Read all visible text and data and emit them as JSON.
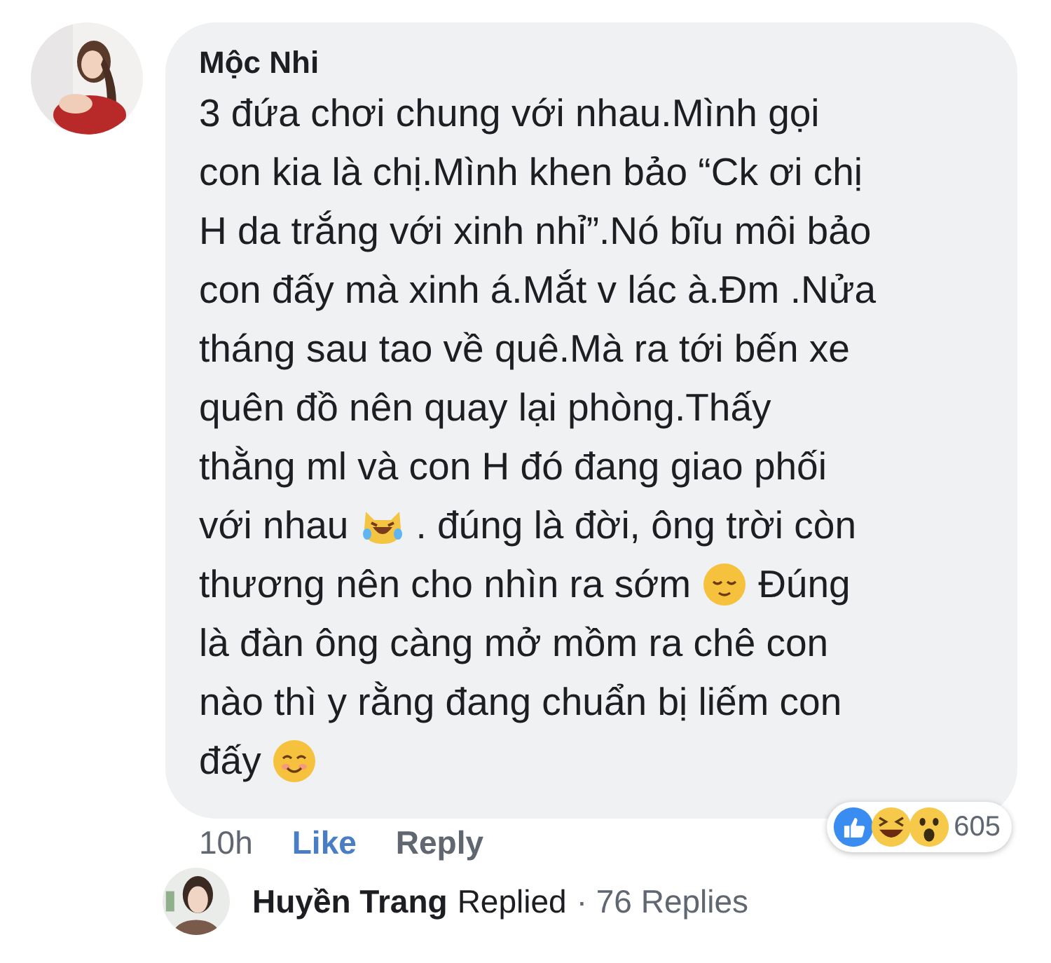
{
  "comment": {
    "author": "Mộc Nhi",
    "lines": [
      [
        {
          "kind": "text",
          "text": "3 đứa chơi chung với nhau.Mình gọi"
        }
      ],
      [
        {
          "kind": "text",
          "text": "con kia là chị.Mình khen bảo “Ck ơi chị"
        }
      ],
      [
        {
          "kind": "text",
          "text": "H da trắng với xinh nhỉ”.Nó bĩu môi bảo"
        }
      ],
      [
        {
          "kind": "text",
          "text": "con đấy mà xinh á.Mắt v lác à.Đm .Nửa"
        }
      ],
      [
        {
          "kind": "text",
          "text": "tháng sau tao về quê.Mà ra tới bến xe"
        }
      ],
      [
        {
          "kind": "text",
          "text": "quên đồ nên quay lại phòng.Thấy"
        }
      ],
      [
        {
          "kind": "text",
          "text": "thằng ml và con H đó đang giao phối"
        }
      ],
      [
        {
          "kind": "text",
          "text": "với nhau"
        },
        {
          "kind": "laugh-cry"
        },
        {
          "kind": "text",
          "text": ". đúng là đời, ông trời còn"
        }
      ],
      [
        {
          "kind": "text",
          "text": "thương nên cho nhìn ra sớm"
        },
        {
          "kind": "relieved"
        },
        {
          "kind": "text",
          "text": "Đúng"
        }
      ],
      [
        {
          "kind": "text",
          "text": "là đàn ông càng mở mồm ra chê con"
        }
      ],
      [
        {
          "kind": "text",
          "text": "nào thì y rằng đang chuẩn bị liếm con"
        }
      ],
      [
        {
          "kind": "text",
          "text": "đấy"
        },
        {
          "kind": "smiling"
        }
      ]
    ],
    "time": "10h",
    "like": "Like",
    "reply": "Reply",
    "reactions": [
      {
        "kind": "like"
      },
      {
        "kind": "haha"
      },
      {
        "kind": "wow"
      }
    ],
    "reaction_count": "605"
  },
  "reply_summary": {
    "name": "Huyền Trang",
    "action": "Replied",
    "count": "· 76 Replies"
  }
}
